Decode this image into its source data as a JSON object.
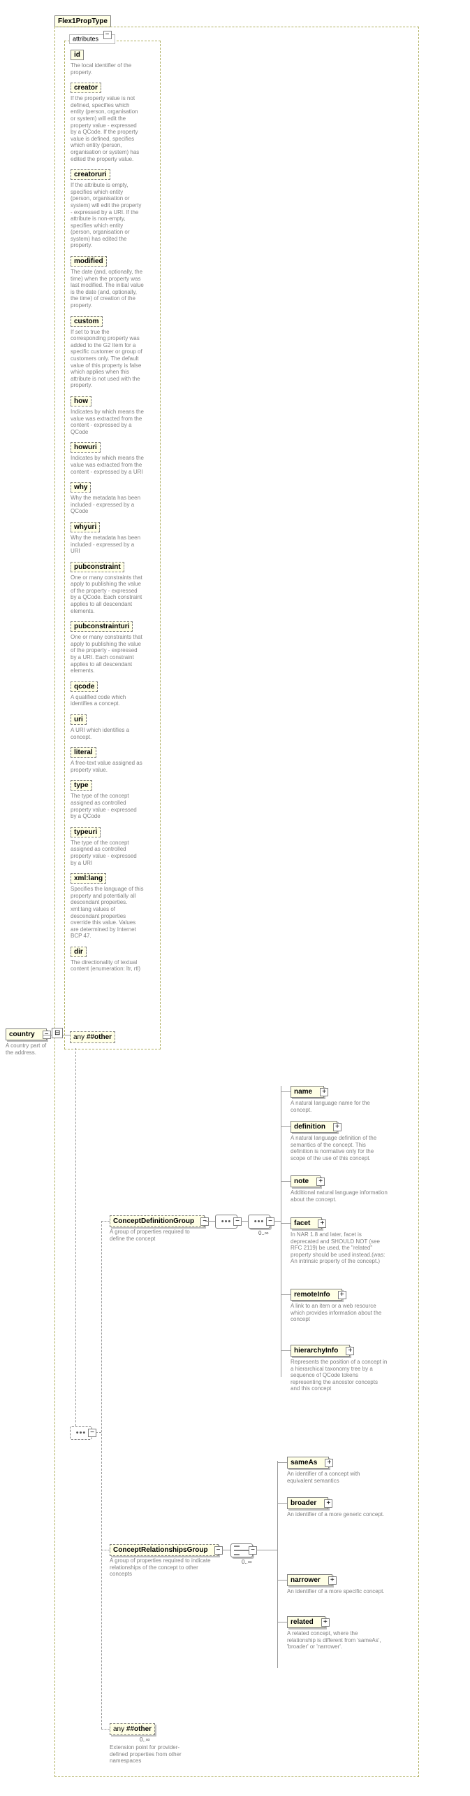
{
  "type_name": "Flex1PropType",
  "attributes_header": "attributes",
  "root": {
    "name": "country",
    "desc": "A country part of the address."
  },
  "sep_label": "⊟",
  "attrs": [
    {
      "name": "id",
      "solid": true,
      "desc": "The local identifier of the property."
    },
    {
      "name": "creator",
      "desc": "If the property value is not defined, specifies which entity (person, organisation or system) will edit the property value - expressed by a QCode. If the property value is defined, specifies which entity (person, organisation or system) has edited the property value."
    },
    {
      "name": "creatoruri",
      "desc": "If the attribute is empty, specifies which entity (person, organisation or system) will edit the property - expressed by a URI. If the attribute is non-empty, specifies which entity (person, organisation or system) has edited the property."
    },
    {
      "name": "modified",
      "desc": "The date (and, optionally, the time) when the property was last modified. The initial value is the date (and, optionally, the time) of creation of the property."
    },
    {
      "name": "custom",
      "desc": "If set to true the corresponding property was added to the G2 Item for a specific customer or group of customers only. The default value of this property is false which applies when this attribute is not used with the property."
    },
    {
      "name": "how",
      "desc": "Indicates by which means the value was extracted from the content - expressed by a QCode"
    },
    {
      "name": "howuri",
      "desc": "Indicates by which means the value was extracted from the content - expressed by a URI"
    },
    {
      "name": "why",
      "desc": "Why the metadata has been included - expressed by a QCode"
    },
    {
      "name": "whyuri",
      "desc": "Why the metadata has been included - expressed by a URI"
    },
    {
      "name": "pubconstraint",
      "desc": "One or many constraints that apply to publishing the value of the property - expressed by a QCode. Each constraint applies to all descendant elements."
    },
    {
      "name": "pubconstrainturi",
      "desc": "One or many constraints that apply to publishing the value of the property - expressed by a URI. Each constraint applies to all descendant elements."
    },
    {
      "name": "qcode",
      "desc": "A qualified code which identifies a concept."
    },
    {
      "name": "uri",
      "desc": "A URI which identifies a concept."
    },
    {
      "name": "literal",
      "desc": "A free-text value assigned as property value."
    },
    {
      "name": "type",
      "desc": "The type of the concept assigned as controlled property value - expressed by a QCode"
    },
    {
      "name": "typeuri",
      "desc": "The type of the concept assigned as controlled property value - expressed by a URI"
    },
    {
      "name": "xml:lang",
      "desc": "Specifies the language of this property and potentially all descendant properties. xml:lang values of descendant properties override this value. Values are determined by Internet BCP 47."
    },
    {
      "name": "dir",
      "desc": "The directionality of textual content (enumeration: ltr, rtl)"
    }
  ],
  "any_attr": {
    "prefix": "any",
    "ns": "##other"
  },
  "groups": {
    "def": {
      "name": "ConceptDefinitionGroup",
      "desc": "A group of properties required to define the concept",
      "card": "0..∞"
    },
    "rel": {
      "name": "ConceptRelationshipsGroup",
      "desc": "A group of properties required to indicate relationships of the concept to other concepts",
      "card": "0..∞"
    }
  },
  "any_elem": {
    "prefix": "any",
    "ns": "##other",
    "card": "0..∞",
    "desc": "Extension point for provider-defined properties from other namespaces"
  },
  "def_children": [
    {
      "name": "name",
      "desc": "A natural language name for the concept."
    },
    {
      "name": "definition",
      "desc": "A natural language definition of the semantics of the concept. This definition is normative only for the scope of the use of this concept."
    },
    {
      "name": "note",
      "desc": "Additional natural language information about the concept."
    },
    {
      "name": "facet",
      "desc": "In NAR 1.8 and later, facet is deprecated and SHOULD NOT (see RFC 2119) be used, the \"related\" property should be used instead.(was: An intrinsic property of the concept.)"
    },
    {
      "name": "remoteInfo",
      "desc": "A link to an item or a web resource which provides information about the concept"
    },
    {
      "name": "hierarchyInfo",
      "desc": "Represents the position of a concept in a hierarchical taxonomy tree by a sequence of QCode tokens representing the ancestor concepts and this concept"
    }
  ],
  "rel_children": [
    {
      "name": "sameAs",
      "desc": "An identifier of a concept with equivalent semantics"
    },
    {
      "name": "broader",
      "desc": "An identifier of a more generic concept."
    },
    {
      "name": "narrower",
      "desc": "An identifier of a more specific concept."
    },
    {
      "name": "related",
      "desc": "A related concept, where the relationship is different from 'sameAs', 'broader' or 'narrower'."
    }
  ]
}
